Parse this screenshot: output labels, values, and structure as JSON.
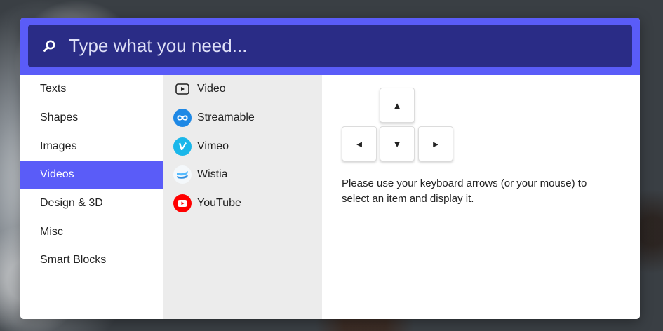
{
  "search": {
    "placeholder": "Type what you need...",
    "icon": "search-icon"
  },
  "categories": [
    {
      "label": "Texts"
    },
    {
      "label": "Shapes"
    },
    {
      "label": "Images"
    },
    {
      "label": "Videos",
      "active": true
    },
    {
      "label": "Design & 3D"
    },
    {
      "label": "Misc"
    },
    {
      "label": "Smart Blocks"
    }
  ],
  "subitems": [
    {
      "label": "Video",
      "icon": "video-play-icon"
    },
    {
      "label": "Streamable",
      "icon": "streamable-icon",
      "color": "#1e88e5"
    },
    {
      "label": "Vimeo",
      "icon": "vimeo-icon",
      "color": "#1ab7ea"
    },
    {
      "label": "Wistia",
      "icon": "wistia-icon",
      "color": "#54bbff"
    },
    {
      "label": "YouTube",
      "icon": "youtube-icon",
      "color": "#ff0000"
    }
  ],
  "keys": {
    "up": "▲",
    "left": "◄",
    "down": "▼",
    "right": "►"
  },
  "help_text": "Please use your keyboard arrows (or your mouse) to select an item and display it.",
  "colors": {
    "accent": "#5a5cf8",
    "search_bg": "#2a2c86",
    "submenu_bg": "#ececec"
  }
}
